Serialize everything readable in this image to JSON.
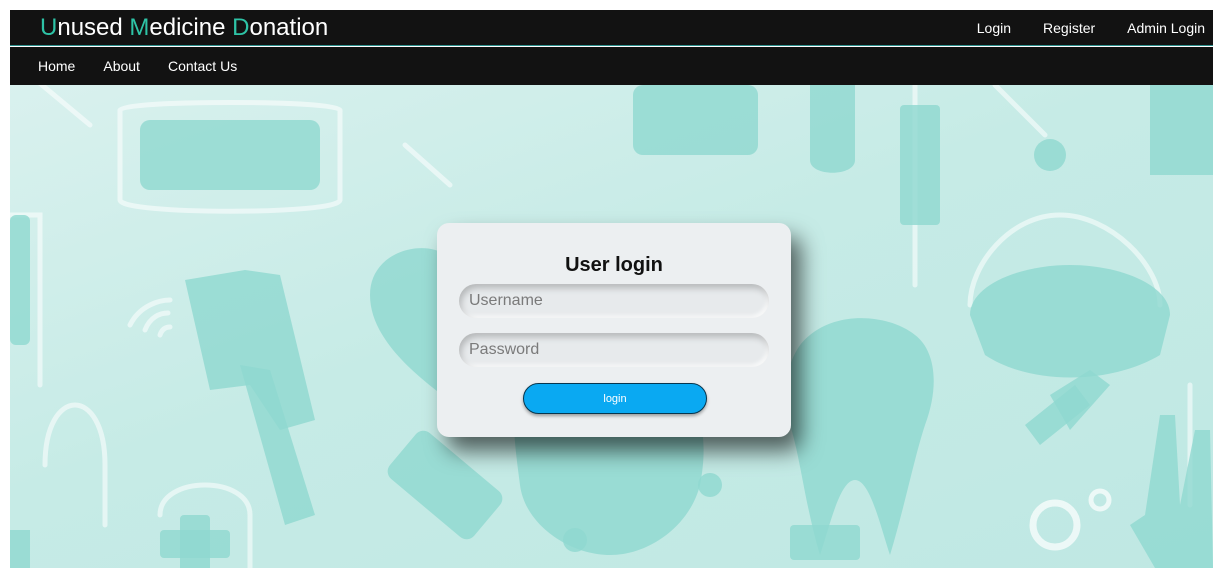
{
  "brand": {
    "parts": [
      {
        "accent": "U",
        "rest": "nused "
      },
      {
        "accent": "M",
        "rest": "edicine "
      },
      {
        "accent": "D",
        "rest": "onation"
      }
    ],
    "accent_color": "#2ec3a6"
  },
  "top_nav": {
    "login": "Login",
    "register": "Register",
    "admin_login": "Admin Login"
  },
  "main_nav": {
    "home": "Home",
    "about": "About",
    "contact": "Contact Us"
  },
  "login_card": {
    "title": "User login",
    "username_placeholder": "Username",
    "password_placeholder": "Password",
    "submit_label": "login"
  },
  "colors": {
    "nav_background": "#121212",
    "button": "#0aa9f2",
    "background_icons": "#8fd8cf"
  }
}
